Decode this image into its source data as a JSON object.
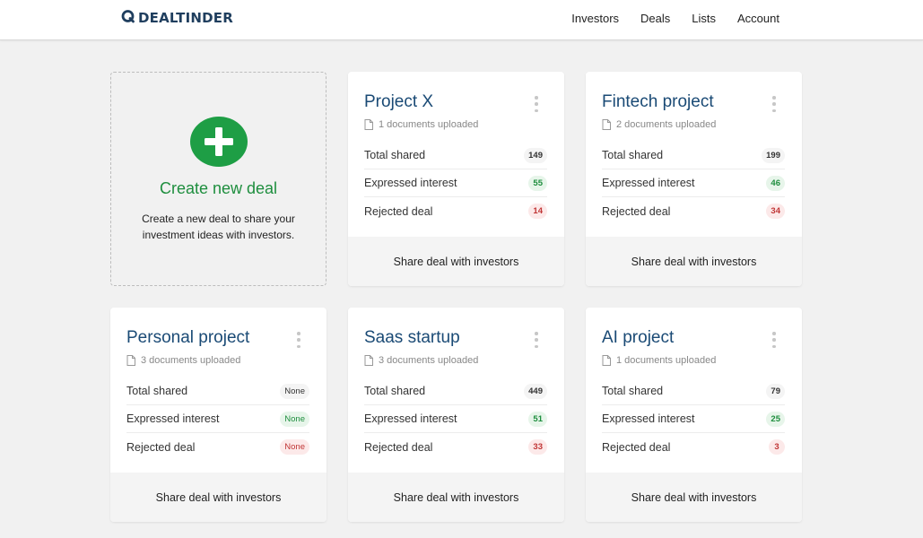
{
  "header": {
    "logo_text": "DEALTINDER",
    "nav": [
      "Investors",
      "Deals",
      "Lists",
      "Account"
    ]
  },
  "create": {
    "title": "Create new deal",
    "description": "Create a new deal to share your investment ideas with investors."
  },
  "labels": {
    "total_shared": "Total shared",
    "expressed_interest": "Expressed interest",
    "rejected_deal": "Rejected deal",
    "share": "Share deal with investors"
  },
  "deals": [
    {
      "title": "Project X",
      "docs": "1 documents uploaded",
      "total": "149",
      "interest": "55",
      "rejected": "14"
    },
    {
      "title": "Fintech project",
      "docs": "2 documents uploaded",
      "total": "199",
      "interest": "46",
      "rejected": "34"
    },
    {
      "title": "Personal project",
      "docs": "3 documents uploaded",
      "total": "None",
      "interest": "None",
      "rejected": "None"
    },
    {
      "title": "Saas startup",
      "docs": "3 documents uploaded",
      "total": "449",
      "interest": "51",
      "rejected": "33"
    },
    {
      "title": "AI project",
      "docs": "1 documents uploaded",
      "total": "79",
      "interest": "25",
      "rejected": "3"
    }
  ],
  "colors": {
    "brand": "#1f3e5e",
    "title": "#1a4a75",
    "green": "#1e8e3e",
    "red": "#c03535"
  }
}
